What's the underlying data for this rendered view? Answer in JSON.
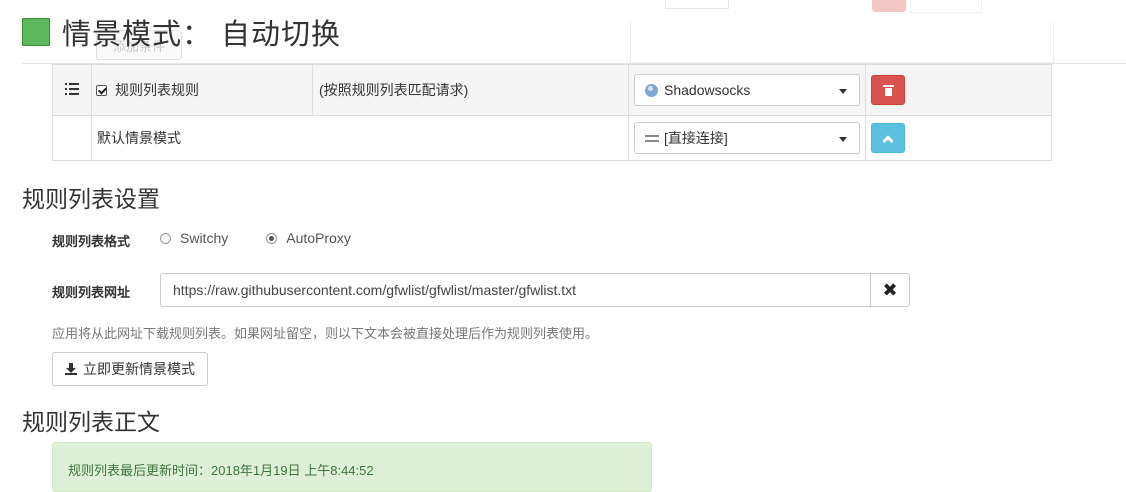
{
  "header": {
    "title": "情景模式： 自动切换",
    "profile_color": "#5cb85c"
  },
  "ghost": {
    "add_condition_label": "添加条件"
  },
  "rules_table": {
    "rows": [
      {
        "condition_type": "规则列表规则",
        "condition_detail": "(按照规则列表匹配请求)",
        "profile": "Shadowsocks",
        "profile_icon": "globe-icon",
        "action": "delete"
      },
      {
        "condition_type": "默认情景模式",
        "profile": "[直接连接]",
        "profile_icon": "direct-icon",
        "action": "move-up"
      }
    ]
  },
  "rule_list_settings": {
    "heading": "规则列表设置",
    "format_label": "规则列表格式",
    "format_options": [
      "Switchy",
      "AutoProxy"
    ],
    "format_selected": "AutoProxy",
    "url_label": "规则列表网址",
    "url_value": "https://raw.githubusercontent.com/gfwlist/gfwlist/master/gfwlist.txt",
    "help_text": "应用将从此网址下载规则列表。如果网址留空，则以下文本会被直接处理后作为规则列表使用。",
    "update_button": "立即更新情景模式"
  },
  "rule_list_text": {
    "heading": "规则列表正文",
    "last_updated": "规则列表最后更新时间：2018年1月19日 上午8:44:52"
  },
  "colors": {
    "danger": "#d9534f",
    "info": "#5bc0de",
    "success_bg": "#dff0d8"
  }
}
